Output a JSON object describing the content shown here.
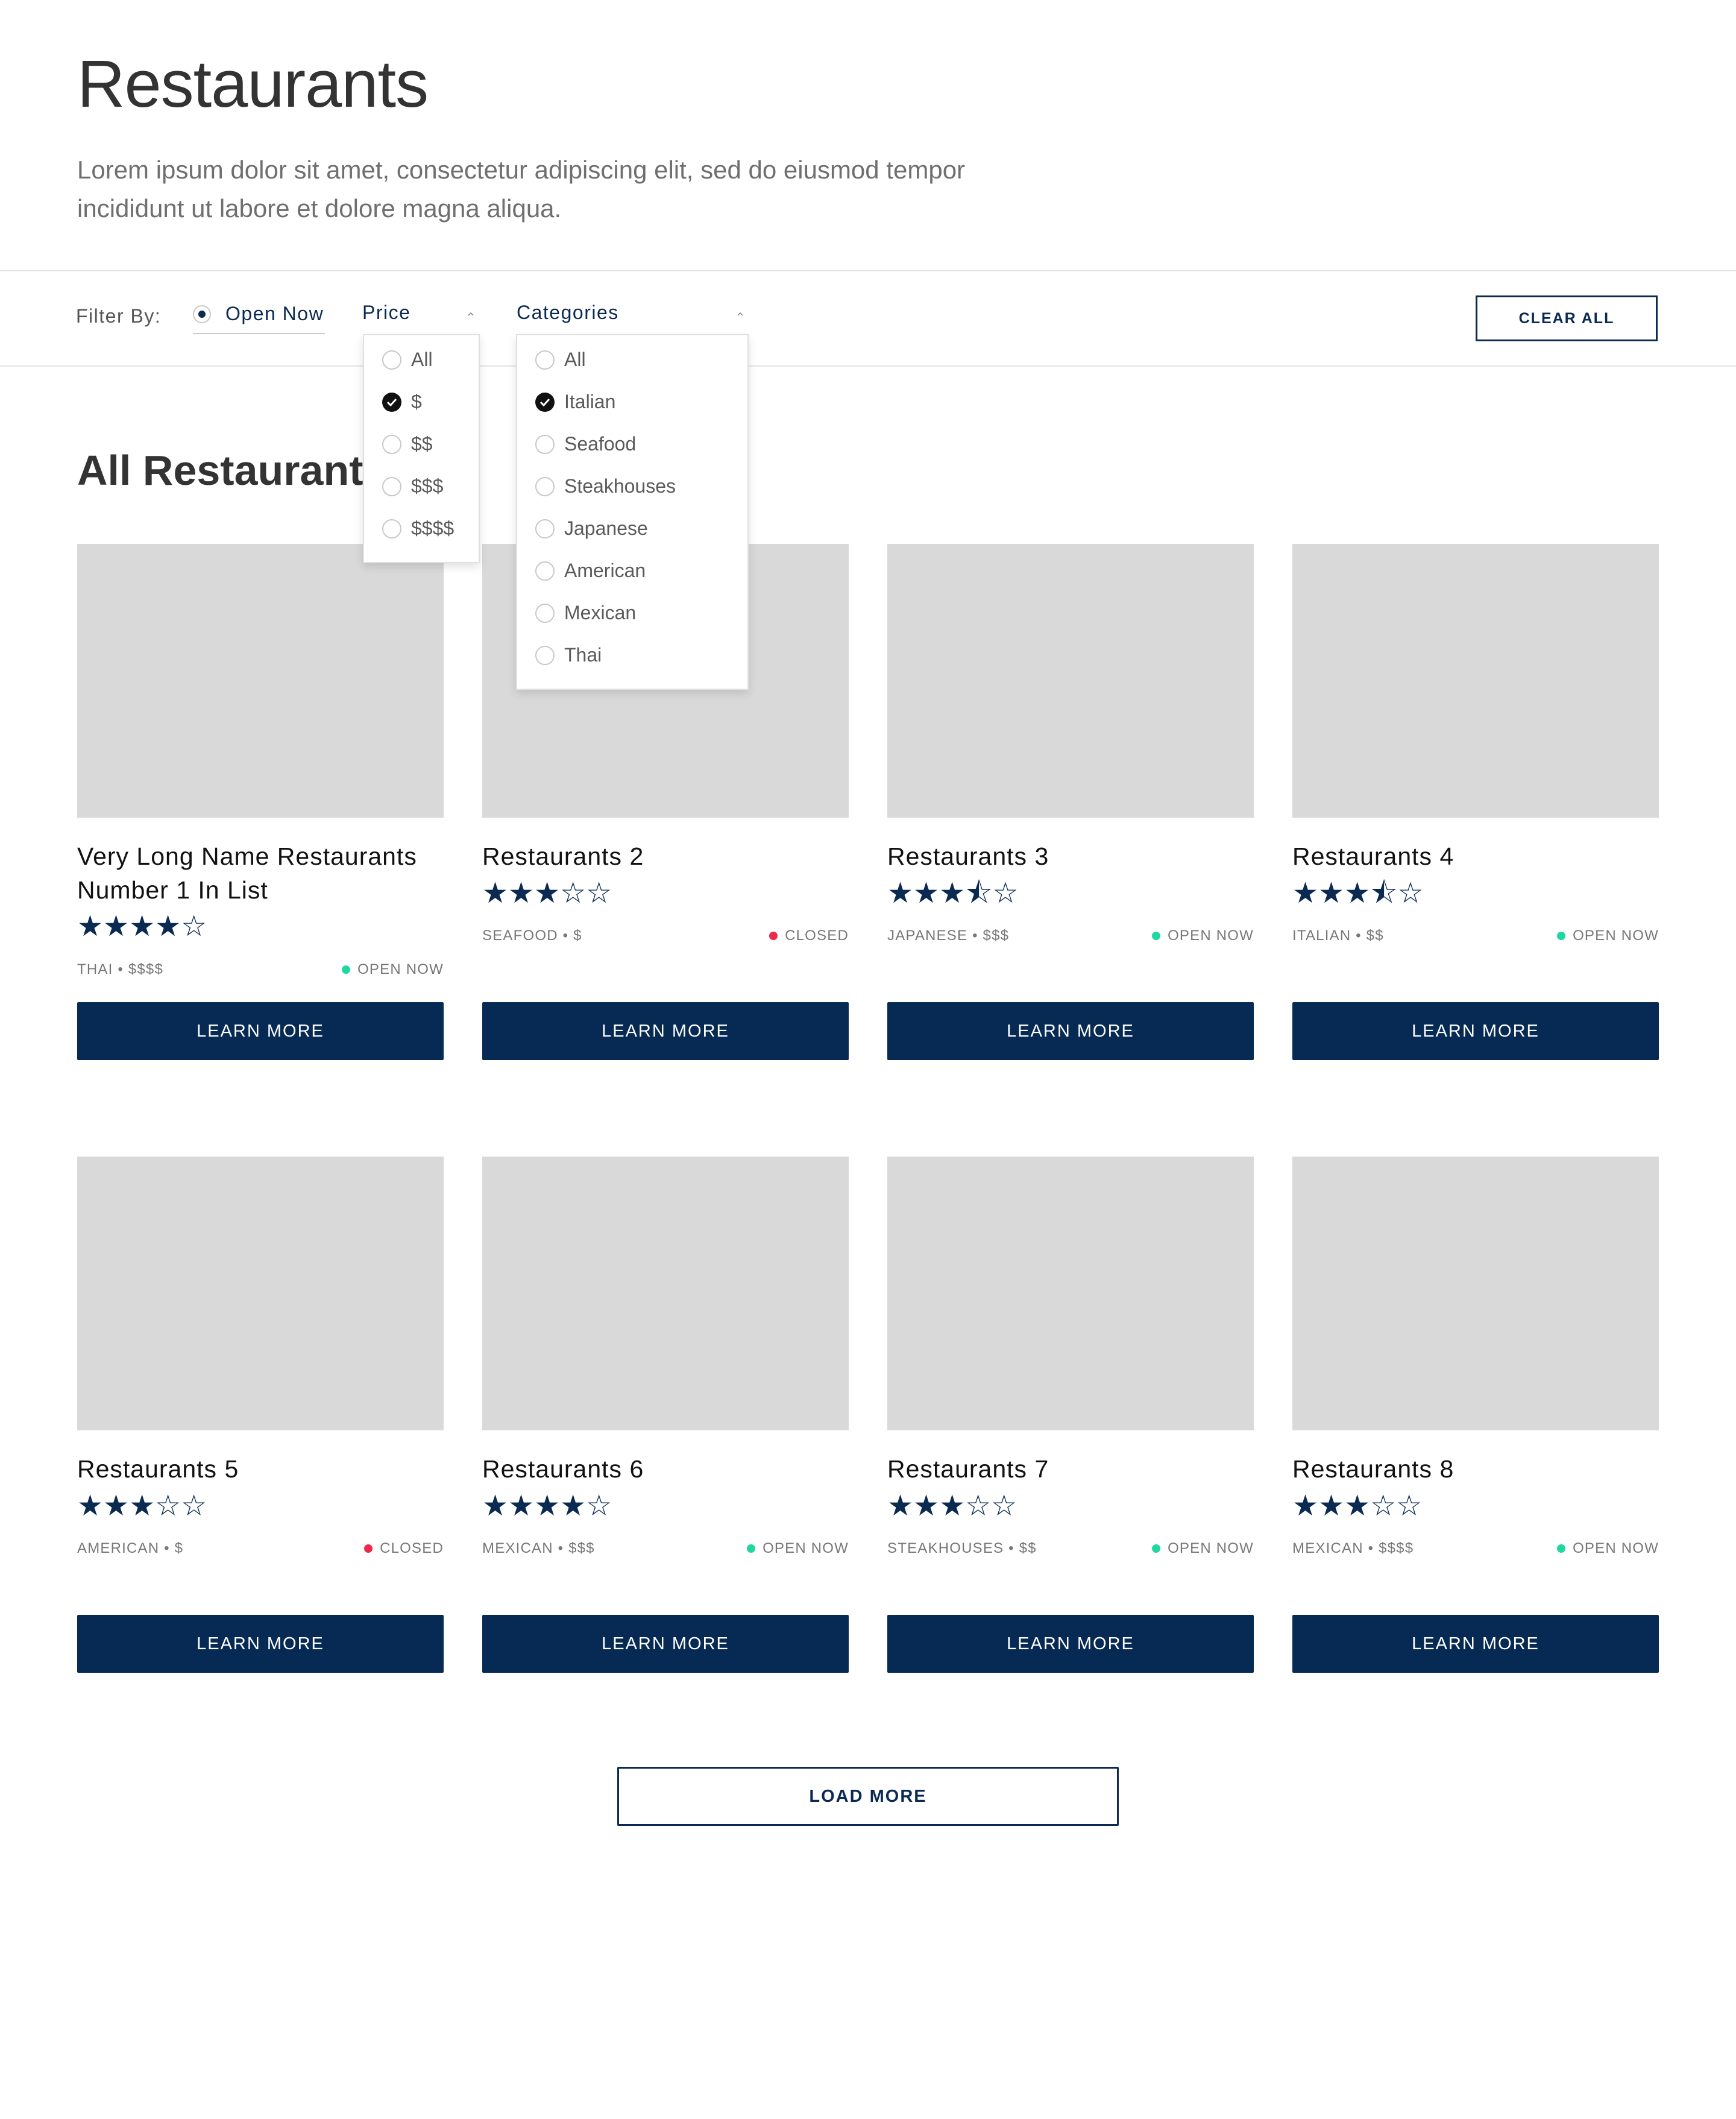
{
  "header": {
    "title": "Restaurants",
    "description": "Lorem ipsum dolor sit amet, consectetur adipiscing elit, sed do eiusmod tempor incididunt ut labore et dolore magna aliqua."
  },
  "filters": {
    "label": "Filter By:",
    "open_now": "Open Now",
    "price": {
      "label": "Price",
      "options": [
        {
          "label": "All",
          "checked": false
        },
        {
          "label": "$",
          "checked": true
        },
        {
          "label": "$$",
          "checked": false
        },
        {
          "label": "$$$",
          "checked": false
        },
        {
          "label": "$$$$",
          "checked": false
        }
      ]
    },
    "categories": {
      "label": "Categories",
      "options": [
        {
          "label": "All",
          "checked": false
        },
        {
          "label": "Italian",
          "checked": true
        },
        {
          "label": "Seafood",
          "checked": false
        },
        {
          "label": "Steakhouses",
          "checked": false
        },
        {
          "label": "Japanese",
          "checked": false
        },
        {
          "label": "American",
          "checked": false
        },
        {
          "label": "Mexican",
          "checked": false
        },
        {
          "label": "Thai",
          "checked": false
        }
      ]
    },
    "clear_all": "CLEAR ALL"
  },
  "section_title": "All Restaurants",
  "colors": {
    "navy": "#062a53",
    "open": "#1fd8a0",
    "closed": "#f0284a",
    "placeholder": "#d9d9d9"
  },
  "restaurants": [
    {
      "name": "Very Long Name Restaurants Number 1 In List",
      "stars": "★★★★☆",
      "meta": "THAI • $$$$",
      "status": "OPEN NOW",
      "status_type": "open",
      "button": "LEARN MORE"
    },
    {
      "name": "Restaurants 2",
      "stars": "★★★☆☆",
      "meta": "SEAFOOD • $",
      "status": "CLOSED",
      "status_type": "closed",
      "button": "LEARN MORE"
    },
    {
      "name": "Restaurants 3",
      "stars": "★★★⯪☆",
      "meta": "JAPANESE • $$$",
      "status": "OPEN NOW",
      "status_type": "open",
      "button": "LEARN MORE"
    },
    {
      "name": "Restaurants 4",
      "stars": "★★★⯪☆",
      "meta": "ITALIAN • $$",
      "status": "OPEN NOW",
      "status_type": "open",
      "button": "LEARN MORE"
    },
    {
      "name": "Restaurants 5",
      "stars": "★★★☆☆",
      "meta": "AMERICAN • $",
      "status": "CLOSED",
      "status_type": "closed",
      "button": "LEARN MORE"
    },
    {
      "name": "Restaurants 6",
      "stars": "★★★★☆",
      "meta": "MEXICAN • $$$",
      "status": "OPEN NOW",
      "status_type": "open",
      "button": "LEARN MORE"
    },
    {
      "name": "Restaurants 7",
      "stars": "★★★☆☆",
      "meta": "STEAKHOUSES • $$",
      "status": "OPEN NOW",
      "status_type": "open",
      "button": "LEARN MORE"
    },
    {
      "name": "Restaurants 8",
      "stars": "★★★☆☆",
      "meta": "MEXICAN • $$$$",
      "status": "OPEN NOW",
      "status_type": "open",
      "button": "LEARN MORE"
    }
  ],
  "load_more": "LOAD MORE"
}
